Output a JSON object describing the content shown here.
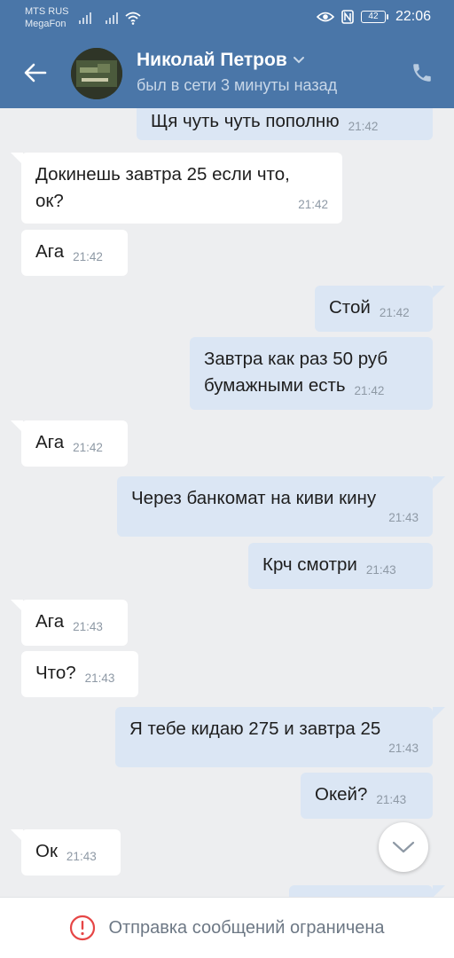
{
  "status_bar": {
    "carrier_1": "MTS RUS",
    "carrier_2": "MegaFon",
    "battery": "42",
    "time": "22:06"
  },
  "header": {
    "contact_name": "Николай Петров",
    "contact_status": "был в сети 3 минуты назад"
  },
  "messages": [
    {
      "dir": "out",
      "text": "Щя чуть чуть пополню",
      "time": "21:42"
    },
    {
      "dir": "in",
      "text_line1": "Докинешь завтра 25 если что,",
      "text_line2": "ок?",
      "time": "21:42"
    },
    {
      "dir": "in",
      "text": "Ага",
      "time": "21:42"
    },
    {
      "dir": "out",
      "text": "Стой",
      "time": "21:42"
    },
    {
      "dir": "out",
      "text_line1": "Завтра как раз 50 руб",
      "text_line2": "бумажными есть",
      "time": "21:42"
    },
    {
      "dir": "in",
      "text": "Ага",
      "time": "21:42"
    },
    {
      "dir": "out",
      "text": "Через банкомат на киви кину",
      "time": "21:43"
    },
    {
      "dir": "out",
      "text": "Крч смотри",
      "time": "21:43"
    },
    {
      "dir": "in",
      "text": "Ага",
      "time": "21:43"
    },
    {
      "dir": "in",
      "text": "Что?",
      "time": "21:43"
    },
    {
      "dir": "out",
      "text": "Я тебе кидаю 275 и завтра 25",
      "time": "21:43"
    },
    {
      "dir": "out",
      "text": "Окей?",
      "time": "21:43"
    },
    {
      "dir": "in",
      "text": "Ок",
      "time": "21:43"
    }
  ],
  "bottom_bar": {
    "restriction_text": "Отправка сообщений ограничена"
  },
  "colors": {
    "header_bg": "#4a76a8",
    "chat_bg": "#edeef0",
    "bubble_in": "#ffffff",
    "bubble_out": "#dbe6f4",
    "warning_icon": "#e64646"
  },
  "icons": [
    "back-arrow-icon",
    "chevron-down-icon",
    "phone-icon",
    "scroll-down-chevron-icon",
    "warning-icon",
    "signal-icon",
    "wifi-icon",
    "eye-icon",
    "nfc-icon",
    "battery-icon"
  ]
}
